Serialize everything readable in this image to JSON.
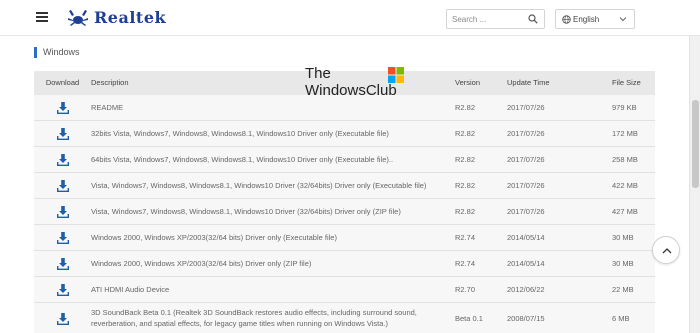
{
  "header": {
    "brand": "Realtek",
    "search_placeholder": "Search ...",
    "language": "English"
  },
  "section": {
    "title": "Windows"
  },
  "watermark": {
    "line1": "The",
    "line2": "WindowsClub"
  },
  "table": {
    "columns": {
      "download": "Download",
      "description": "Description",
      "version": "Version",
      "update_time": "Update Time",
      "file_size": "File Size"
    },
    "rows": [
      {
        "description": "README",
        "version": "R2.82",
        "update_time": "2017/07/26",
        "file_size": "979 KB"
      },
      {
        "description": "32bits Vista, Windows7, Windows8, Windows8.1, Windows10 Driver only (Executable file)",
        "version": "R2.82",
        "update_time": "2017/07/26",
        "file_size": "172 MB"
      },
      {
        "description": "64bits Vista, Windows7, Windows8, Windows8.1, Windows10 Driver only (Executable file)..",
        "version": "R2.82",
        "update_time": "2017/07/26",
        "file_size": "258 MB"
      },
      {
        "description": "Vista, Windows7, Windows8, Windows8.1, Windows10 Driver (32/64bits) Driver only (Executable file)",
        "version": "R2.82",
        "update_time": "2017/07/26",
        "file_size": "422 MB"
      },
      {
        "description": "Vista, Windows7, Windows8, Windows8.1, Windows10 Driver (32/64bits) Driver only (ZIP file)",
        "version": "R2.82",
        "update_time": "2017/07/26",
        "file_size": "427 MB"
      },
      {
        "description": "Windows 2000, Windows XP/2003(32/64 bits) Driver only (Executable file)",
        "version": "R2.74",
        "update_time": "2014/05/14",
        "file_size": "30 MB"
      },
      {
        "description": "Windows 2000, Windows XP/2003(32/64 bits) Driver only (ZIP file)",
        "version": "R2.74",
        "update_time": "2014/05/14",
        "file_size": "30 MB"
      },
      {
        "description": "ATI HDMI Audio Device",
        "version": "R2.70",
        "update_time": "2012/06/22",
        "file_size": "22 MB"
      },
      {
        "description": "3D SoundBack Beta 0.1 (Realtek 3D SoundBack restores audio effects, including surround sound, reverberation, and spatial effects, for legacy game titles when running on Windows Vista.)",
        "version": "Beta 0.1",
        "update_time": "2008/07/15",
        "file_size": "6 MB"
      }
    ]
  },
  "colors": {
    "brand": "#1e3f94",
    "download_icon": "#1f5fa6",
    "section_accent": "#2f6fc1",
    "header_row": "#e8e8e8",
    "row_bg": "#f7f7f7"
  },
  "icons": [
    "menu-icon",
    "realtek-crab-logo",
    "search-icon",
    "globe-icon",
    "chevron-down-icon",
    "download-icon",
    "windows-logo-icon",
    "chevron-up-icon"
  ]
}
